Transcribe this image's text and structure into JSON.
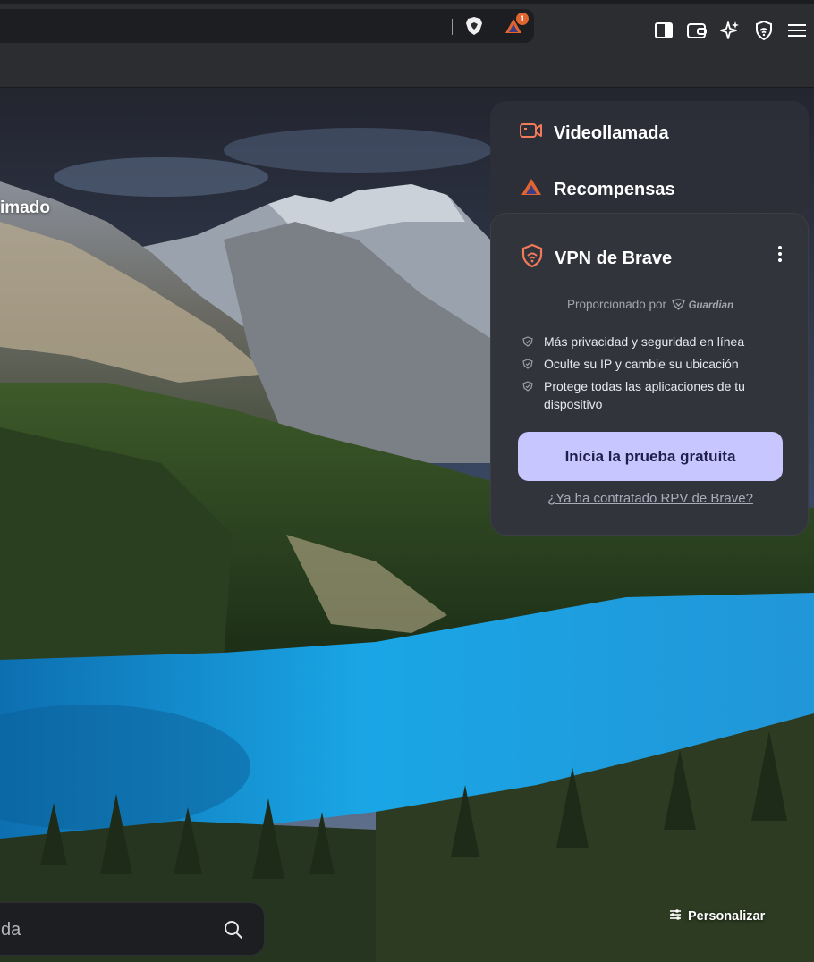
{
  "toolbar": {
    "icons": [
      "brave-shields-icon",
      "rewards-icon",
      "sidebar-icon",
      "wallet-icon",
      "leo-ai-icon",
      "vpn-icon",
      "menu-icon"
    ],
    "rewards_badge": "1"
  },
  "ntp": {
    "stat_label_partial": "imado",
    "search_placeholder_partial": "da",
    "customize_label": "Personalizar"
  },
  "panel": {
    "video_call_label": "Videollamada",
    "rewards_label": "Recompensas",
    "vpn": {
      "title": "VPN de Brave",
      "provided_by": "Proporcionado por",
      "provider": "Guardian",
      "features": [
        "Más privacidad y seguridad en línea",
        "Oculte su IP y cambie su ubicación",
        "Protege todas las aplicaciones de tu dispositivo"
      ],
      "cta_label": "Inicia la prueba gratuita",
      "already_link": "¿Ya ha contratado RPV de Brave?"
    }
  },
  "colors": {
    "chrome": "#2c2d31",
    "urlbar": "#1d1e22",
    "accent_orange": "#e2652f",
    "cta_bg": "#c8c6ff",
    "cta_text": "#1e1f4a",
    "lake": "#1aa6e6"
  }
}
